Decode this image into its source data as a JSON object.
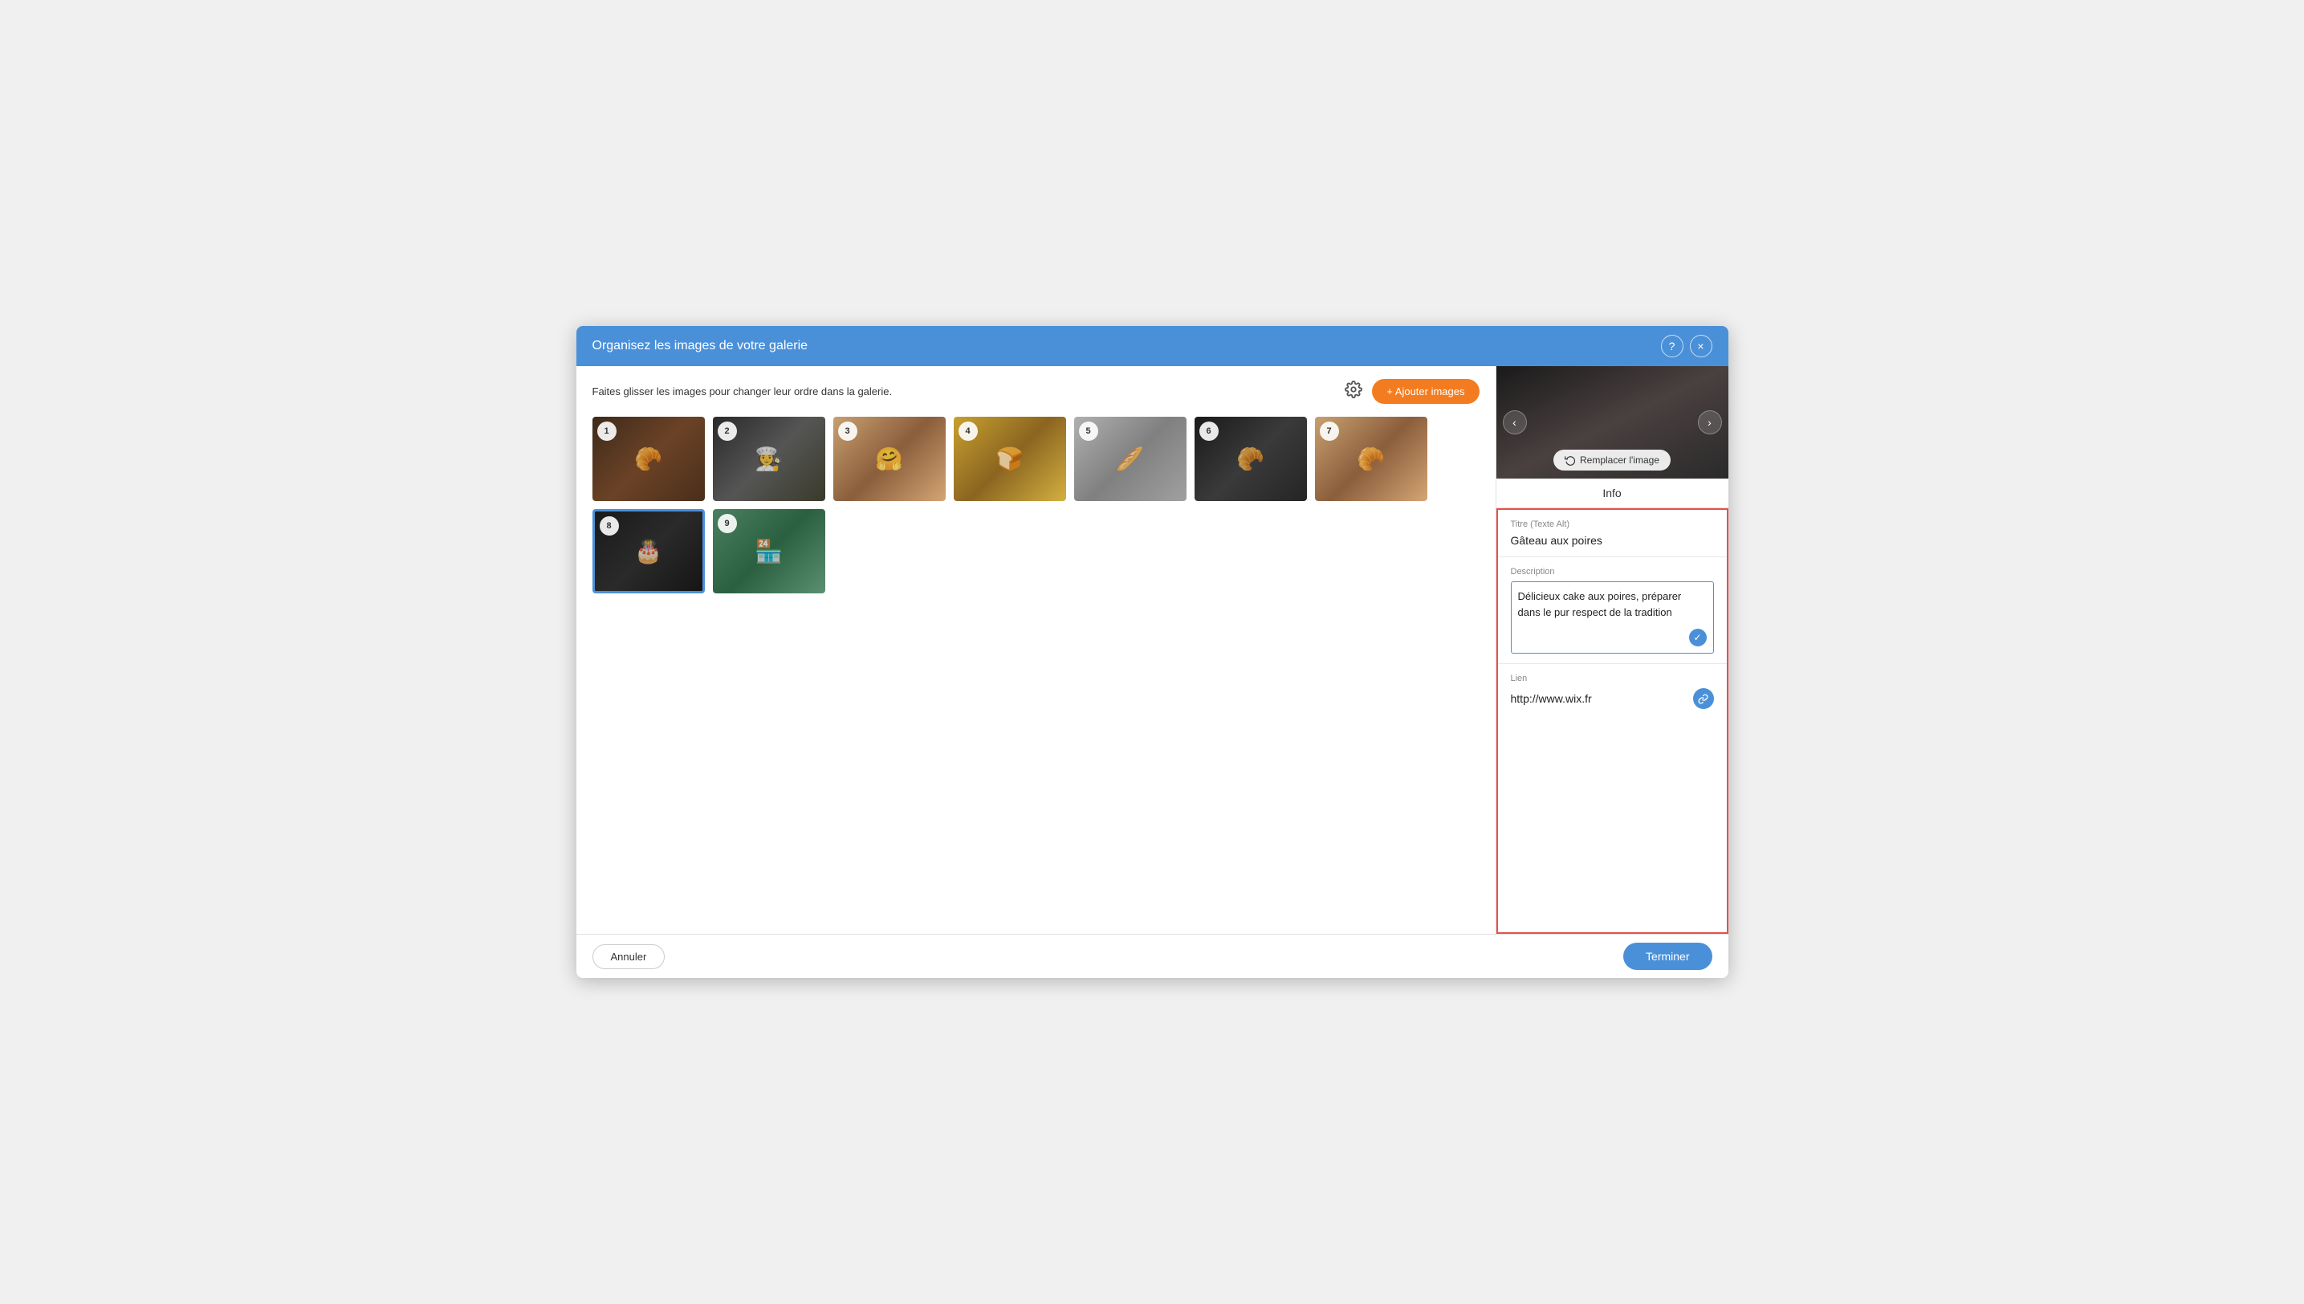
{
  "modal": {
    "title": "Organisez les images de votre galerie",
    "help_label": "?",
    "close_label": "×"
  },
  "gallery": {
    "hint": "Faites glisser les images pour changer leur ordre dans la galerie.",
    "add_images_label": "+ Ajouter images",
    "images": [
      {
        "num": "1",
        "bg": "bg-1",
        "emoji": "🥐",
        "selected": false
      },
      {
        "num": "2",
        "bg": "bg-2",
        "emoji": "👩‍🍳",
        "selected": false
      },
      {
        "num": "3",
        "bg": "bg-3",
        "emoji": "🤗",
        "selected": false
      },
      {
        "num": "4",
        "bg": "bg-4",
        "emoji": "🍞",
        "selected": false
      },
      {
        "num": "5",
        "bg": "bg-5",
        "emoji": "🥖",
        "selected": false
      },
      {
        "num": "6",
        "bg": "bg-6",
        "emoji": "🥐",
        "selected": false
      },
      {
        "num": "7",
        "bg": "bg-7",
        "emoji": "🥐",
        "selected": false
      },
      {
        "num": "8",
        "bg": "bg-8",
        "emoji": "🎂",
        "selected": true
      },
      {
        "num": "9",
        "bg": "bg-9",
        "emoji": "🏪",
        "selected": false
      }
    ]
  },
  "right_panel": {
    "prev_btn": "‹",
    "next_btn": "›",
    "replace_label": "Remplacer l'image",
    "info_tab_label": "Info",
    "title_label": "Titre (Texte Alt)",
    "title_value": "Gâteau aux poires",
    "description_label": "Description",
    "description_value": "Délicieux cake aux poires, préparer dans le pur respect de la tradition",
    "link_label": "Lien",
    "link_value": "http://www.wix.fr"
  },
  "footer": {
    "cancel_label": "Annuler",
    "finish_label": "Terminer"
  }
}
